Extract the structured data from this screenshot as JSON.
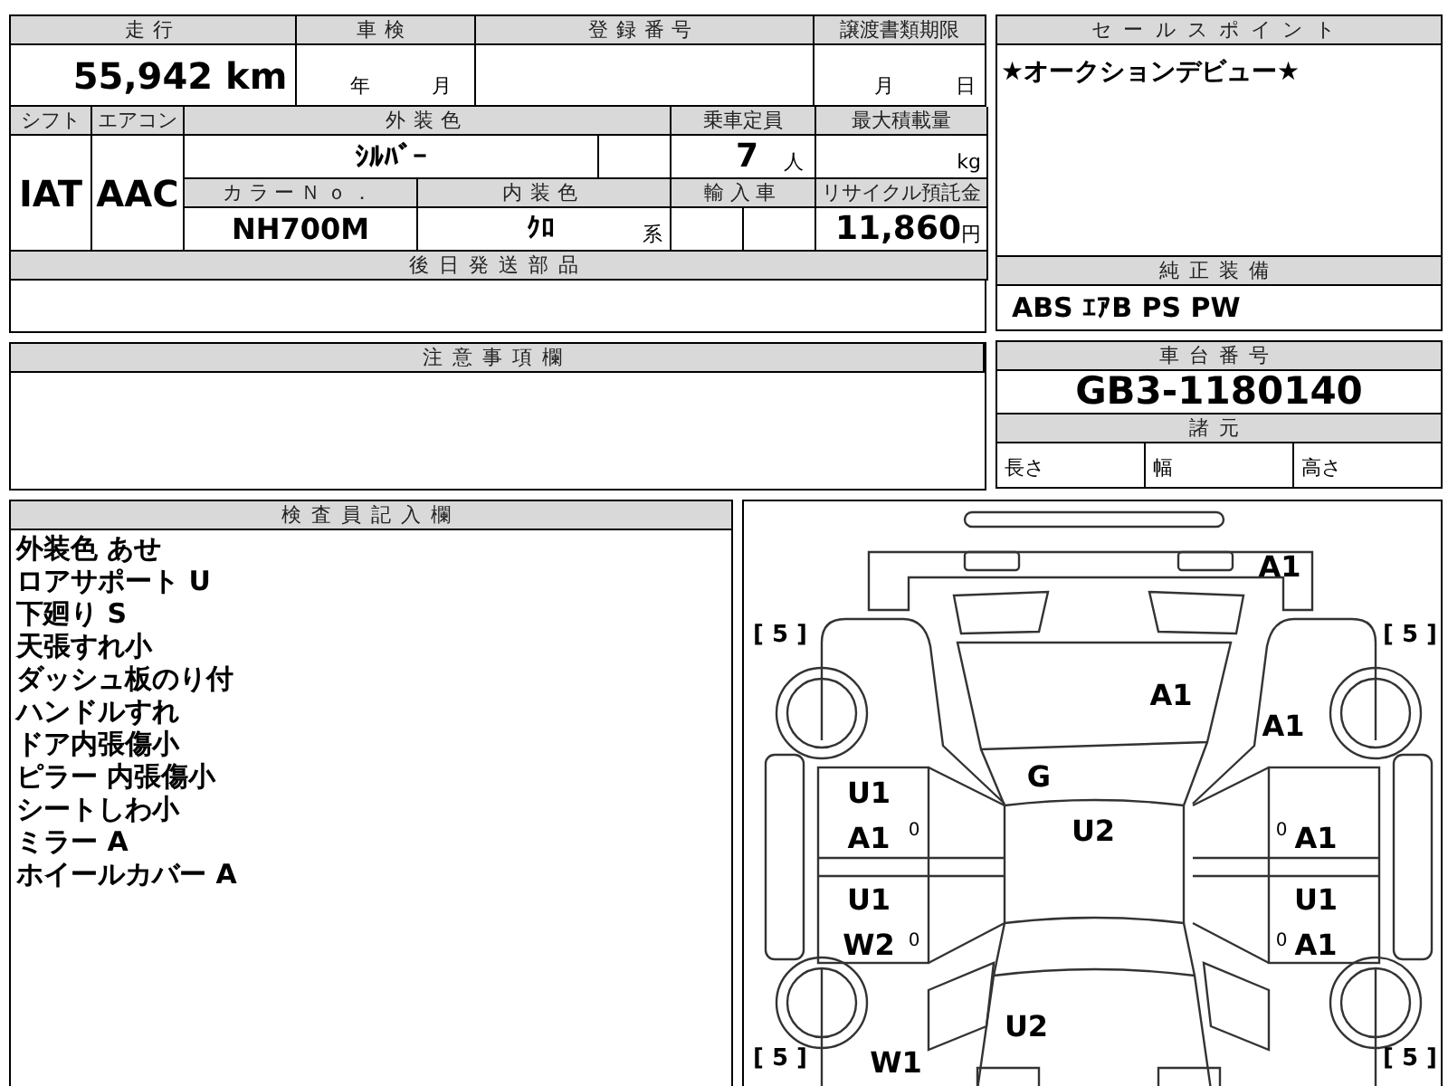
{
  "mileage": {
    "label": "走行",
    "value": "55,942",
    "unit": "km"
  },
  "shaken": {
    "label": "車検",
    "year_unit": "年",
    "month_unit": "月"
  },
  "registration_number": {
    "label": "登録番号"
  },
  "transfer_deadline": {
    "label": "譲渡書類期限",
    "month_unit": "月",
    "day_unit": "日"
  },
  "shift": {
    "label": "シフト",
    "value": "IAT"
  },
  "aircon": {
    "label": "エアコン",
    "value": "AAC"
  },
  "exterior_color": {
    "label": "外装色",
    "value": "ｼﾙﾊﾞｰ"
  },
  "capacity": {
    "label": "乗車定員",
    "value": "7",
    "unit": "人"
  },
  "max_load": {
    "label": "最大積載量",
    "unit": "kg"
  },
  "color_no": {
    "label": "カラーＮｏ．",
    "value": "NH700M"
  },
  "interior_color": {
    "label": "内装色",
    "value": "ｸﾛ",
    "suffix": "系"
  },
  "import_car": {
    "label": "輸入車"
  },
  "recycle_fee": {
    "label": "リサイクル預託金",
    "value": "11,860",
    "unit": "円"
  },
  "later_parts": {
    "label": "後日発送部品"
  },
  "notes": {
    "label": "注意事項欄"
  },
  "sales_point": {
    "label": "セールスポイント",
    "text": "★オークションデビュー★"
  },
  "equipment": {
    "label": "純正装備",
    "value": "ABS ｴｱB PS PW"
  },
  "chassis": {
    "label": "車台番号",
    "value": "GB3-1180140"
  },
  "specs": {
    "label": "諸元",
    "items": [
      "長さ",
      "幅",
      "高さ"
    ]
  },
  "inspector": {
    "label": "検査員記入欄",
    "lines": [
      "外装色 あせ",
      "ロアサポート U",
      "下廻り S",
      "天張すれ小",
      "ダッシュ板のり付",
      "ハンドルすれ",
      "ドア内張傷小",
      "ピラー 内張傷小",
      "シートしわ小",
      "ミラー A",
      "ホイールカバー A"
    ]
  },
  "diagram": {
    "tire_marks": [
      "[ 5 ]",
      "[ 5 ]",
      "[ 5 ]",
      "[ 5 ]"
    ],
    "damage_marks": [
      "A1",
      "A1",
      "A1",
      "G",
      "U1",
      "A1",
      "U2",
      "A1",
      "U1",
      "W2",
      "U1",
      "A1",
      "U2",
      "W1"
    ],
    "tread_marks": [
      "0",
      "0",
      "0",
      "0"
    ]
  }
}
